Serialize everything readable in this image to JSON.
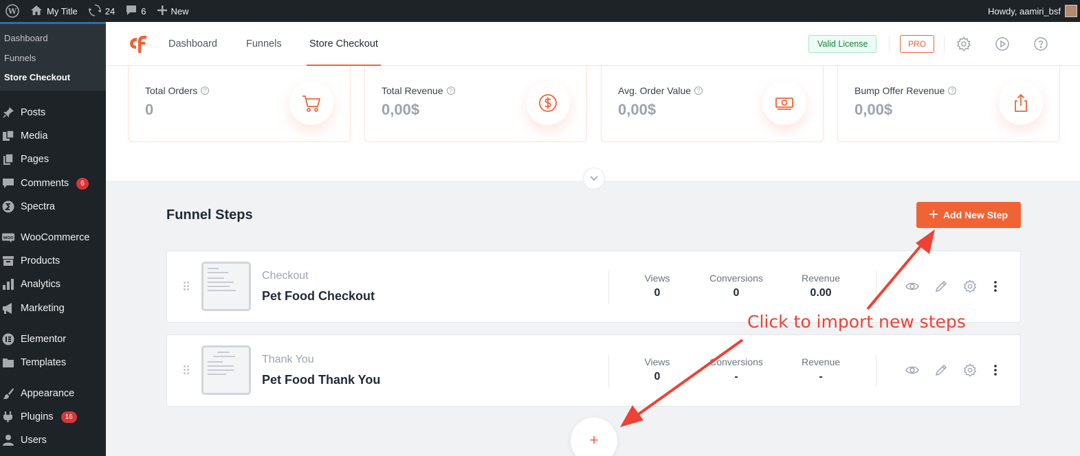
{
  "admin_bar": {
    "site_title": "My Title",
    "updates_count": "24",
    "comments_count": "6",
    "new_label": "New",
    "greeting": "Howdy, aamiri_bsf"
  },
  "sidebar": {
    "submenu": [
      {
        "label": "Dashboard",
        "current": false
      },
      {
        "label": "Funnels",
        "current": false
      },
      {
        "label": "Store Checkout",
        "current": true
      }
    ],
    "items": [
      {
        "label": "Posts",
        "icon": "pin-icon"
      },
      {
        "label": "Media",
        "icon": "media-icon"
      },
      {
        "label": "Pages",
        "icon": "pages-icon"
      },
      {
        "label": "Comments",
        "icon": "comments-icon",
        "badge": "6"
      },
      {
        "label": "Spectra",
        "icon": "spectra-icon"
      },
      {
        "label": "WooCommerce",
        "icon": "woo-icon"
      },
      {
        "label": "Products",
        "icon": "archive-icon"
      },
      {
        "label": "Analytics",
        "icon": "chart-bar-icon"
      },
      {
        "label": "Marketing",
        "icon": "megaphone-icon"
      },
      {
        "label": "Elementor",
        "icon": "elementor-icon"
      },
      {
        "label": "Templates",
        "icon": "folder-icon"
      },
      {
        "label": "Appearance",
        "icon": "brush-icon"
      },
      {
        "label": "Plugins",
        "icon": "plugin-icon",
        "badge": "16"
      },
      {
        "label": "Users",
        "icon": "users-icon"
      }
    ]
  },
  "header": {
    "tabs": [
      {
        "label": "Dashboard",
        "active": false
      },
      {
        "label": "Funnels",
        "active": false
      },
      {
        "label": "Store Checkout",
        "active": true
      }
    ],
    "license_label": "Valid License",
    "pro_label": "PRO"
  },
  "stats": [
    {
      "label": "Total Orders",
      "value": "0",
      "icon": "cart-icon"
    },
    {
      "label": "Total Revenue",
      "value": "0,00$",
      "icon": "dollar-circle-icon"
    },
    {
      "label": "Avg. Order Value",
      "value": "0,00$",
      "icon": "cash-icon"
    },
    {
      "label": "Bump Offer Revenue",
      "value": "0,00$",
      "icon": "share-upload-icon"
    }
  ],
  "funnel_steps": {
    "title": "Funnel Steps",
    "add_button_label": "Add New Step",
    "metric_labels": {
      "views": "Views",
      "conversions": "Conversions",
      "revenue": "Revenue"
    },
    "steps": [
      {
        "type": "Checkout",
        "name": "Pet Food Checkout",
        "views": "0",
        "conversions": "0",
        "revenue": "0.00"
      },
      {
        "type": "Thank You",
        "name": "Pet Food Thank You",
        "views": "0",
        "conversions": "-",
        "revenue": "-"
      }
    ],
    "add_step_plus": "+"
  },
  "annotation": {
    "text": "Click to import new steps",
    "color": "#ef4135"
  },
  "colors": {
    "accent": "#f06335",
    "admin_dark": "#1d2327",
    "success": "#15803d"
  }
}
